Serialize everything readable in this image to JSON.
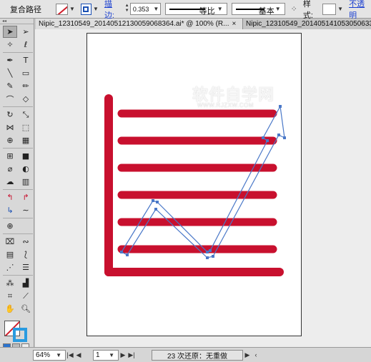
{
  "control_bar": {
    "title": "复合路径",
    "stroke_label": "描边:",
    "stroke_width": "0.353",
    "line_profile_label": "等比",
    "brush_label": "基本",
    "style_label": "样式:",
    "opacity_label": "不透明"
  },
  "tabs": [
    {
      "label": "Nipic_12310549_20140512130059068364.ai* @ 100% (R...",
      "close": "×"
    },
    {
      "label": "Nipic_12310549_201405141053050633",
      "close": ""
    }
  ],
  "artwork": {
    "bar_color": "#c8102e",
    "path_color": "#4a78c8",
    "watermark": "软件自学网",
    "watermark_url": "WWW.RJZXW.COM"
  },
  "status_bar": {
    "zoom": "64%",
    "page": "1",
    "status_text": "23 次还原：无重做"
  }
}
